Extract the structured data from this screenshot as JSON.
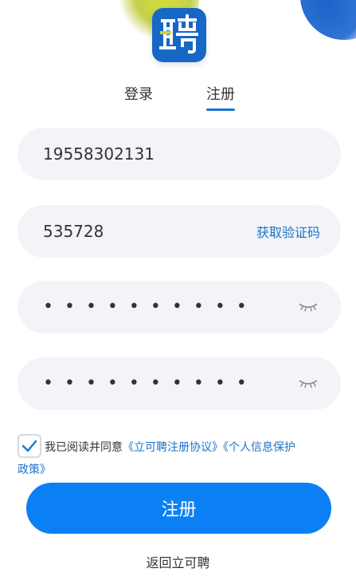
{
  "colors": {
    "brand_blue": "#1767c6",
    "accent": "#0b80f4",
    "link": "#1a73c8",
    "field_bg": "#f3f4f8"
  },
  "logo": {
    "icon": "pin-logo-icon",
    "glyph": "聘"
  },
  "tabs": {
    "login_label": "登录",
    "register_label": "注册",
    "active": "register"
  },
  "form": {
    "phone_value": "19558302131",
    "code_value": "535728",
    "get_code_label": "获取验证码",
    "password_mask": "••••••••••",
    "confirm_password_mask": "••••••••••",
    "eye_icon": "eye-closed-icon"
  },
  "agreement": {
    "checked": true,
    "prefix": "我已阅读并同意",
    "link1": "《立可聘注册协议》",
    "link2_part1": "《个人信息保护",
    "link2_part2": "政策》"
  },
  "submit_label": "注册",
  "back_label": "返回立可聘"
}
